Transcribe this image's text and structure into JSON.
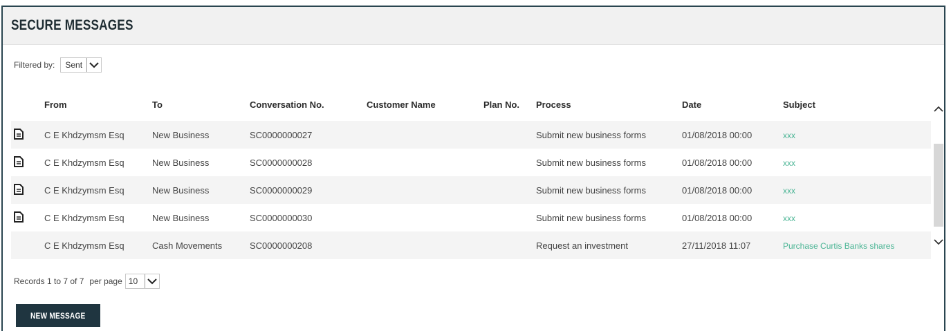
{
  "panel": {
    "title": "SECURE MESSAGES"
  },
  "filter": {
    "label": "Filtered by:",
    "value": "Sent"
  },
  "columns": [
    "From",
    "To",
    "Conversation No.",
    "Customer Name",
    "Plan No.",
    "Process",
    "Date",
    "Subject"
  ],
  "rows": [
    {
      "has_icon": true,
      "from": "C E Khdzymsm Esq",
      "to": "New Business",
      "conversation": "SC0000000027",
      "customer": "",
      "plan": "",
      "process": "Submit new business forms",
      "date": "01/08/2018 00:00",
      "subject": "xxx"
    },
    {
      "has_icon": true,
      "from": "C E Khdzymsm Esq",
      "to": "New Business",
      "conversation": "SC0000000028",
      "customer": "",
      "plan": "",
      "process": "Submit new business forms",
      "date": "01/08/2018 00:00",
      "subject": "xxx"
    },
    {
      "has_icon": true,
      "from": "C E Khdzymsm Esq",
      "to": "New Business",
      "conversation": "SC0000000029",
      "customer": "",
      "plan": "",
      "process": "Submit new business forms",
      "date": "01/08/2018 00:00",
      "subject": "xxx"
    },
    {
      "has_icon": true,
      "from": "C E Khdzymsm Esq",
      "to": "New Business",
      "conversation": "SC0000000030",
      "customer": "",
      "plan": "",
      "process": "Submit new business forms",
      "date": "01/08/2018 00:00",
      "subject": "xxx"
    },
    {
      "has_icon": false,
      "from": "C E Khdzymsm Esq",
      "to": "Cash Movements",
      "conversation": "SC0000000208",
      "customer": "",
      "plan": "",
      "process": "Request an investment",
      "date": "27/11/2018 11:07",
      "subject": "Purchase Curtis Banks shares"
    }
  ],
  "pagination": {
    "records_text": "Records 1 to 7 of 7",
    "per_page_label": "per page",
    "per_page_value": "10"
  },
  "actions": {
    "new_message_label": "NEW MESSAGE"
  },
  "colors": {
    "border": "#2a4550",
    "button": "#1f3540",
    "link": "#4bb595"
  },
  "icons": {
    "row_icon": "document-icon",
    "dropdown": "chevron-down-icon",
    "scroll_up": "chevron-up-icon",
    "scroll_down": "chevron-down-icon"
  }
}
